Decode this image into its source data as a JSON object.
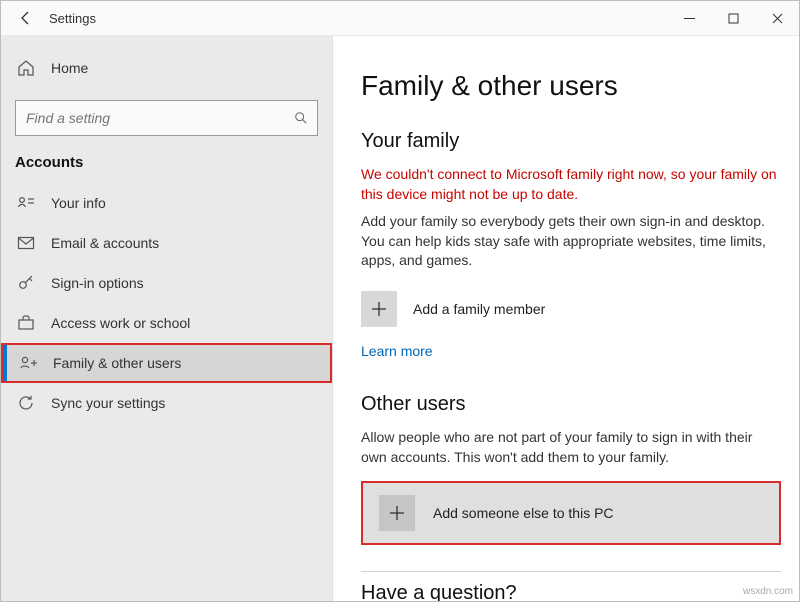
{
  "titlebar": {
    "title": "Settings"
  },
  "sidebar": {
    "home_label": "Home",
    "search_placeholder": "Find a setting",
    "section": "Accounts",
    "items": [
      {
        "label": "Your info"
      },
      {
        "label": "Email & accounts"
      },
      {
        "label": "Sign-in options"
      },
      {
        "label": "Access work or school"
      },
      {
        "label": "Family & other users"
      },
      {
        "label": "Sync your settings"
      }
    ]
  },
  "main": {
    "page_title": "Family & other users",
    "your_family_heading": "Your family",
    "error": "We couldn't connect to Microsoft family right now, so your family on this device might not be up to date.",
    "family_text": "Add your family so everybody gets their own sign-in and desktop. You can help kids stay safe with appropriate websites, time limits, apps, and games.",
    "add_family_label": "Add a family member",
    "learn_more": "Learn more",
    "other_heading": "Other users",
    "other_text": "Allow people who are not part of your family to sign in with their own accounts. This won't add them to your family.",
    "add_other_label": "Add someone else to this PC",
    "question_heading": "Have a question?"
  },
  "watermark": "wsxdn.com"
}
